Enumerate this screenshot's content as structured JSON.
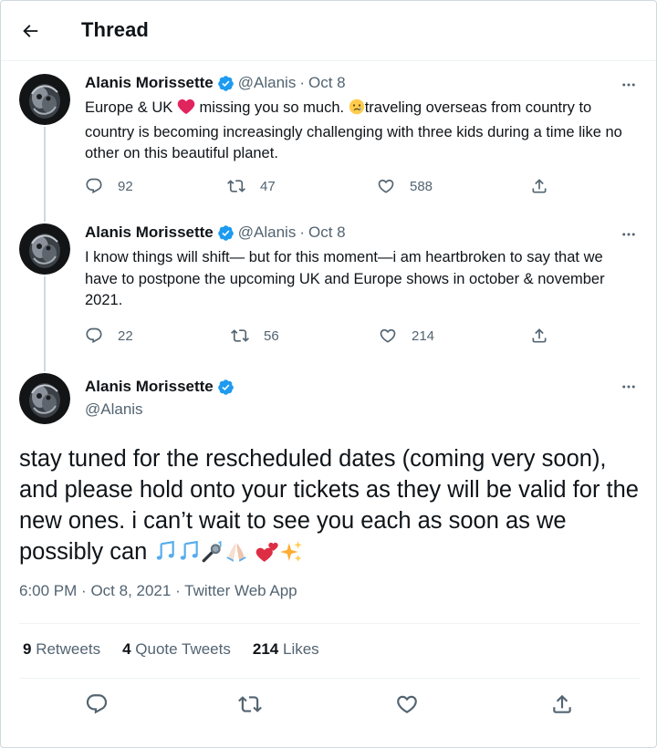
{
  "header": {
    "title": "Thread"
  },
  "tweets": [
    {
      "name": "Alanis Morissette",
      "handle": "@Alanis",
      "dot": "·",
      "date": "Oct 8",
      "text_a": "Europe & UK ",
      "text_b": " missing you so much. ",
      "text_c": "traveling overseas from country to country is becoming increasingly challenging with three kids during a time like no other on this beautiful planet.",
      "replies": "92",
      "retweets": "47",
      "likes": "588"
    },
    {
      "name": "Alanis Morissette",
      "handle": "@Alanis",
      "dot": "·",
      "date": "Oct 8",
      "text": "I know things will shift— but for this moment—i am heartbroken to say that we have to postpone the upcoming UK and Europe shows in october & november 2021.",
      "replies": "22",
      "retweets": "56",
      "likes": "214"
    }
  ],
  "main_tweet": {
    "name": "Alanis Morissette",
    "handle": "@Alanis",
    "text": "stay tuned for the rescheduled dates (coming very soon), and please hold onto your tickets as they will be valid for the new ones. i can’t wait to see you each as soon as we possibly can ",
    "time": "6:00 PM",
    "dot": "·",
    "date": "Oct 8, 2021",
    "source": "Twitter Web App",
    "retweets_count": "9",
    "retweets_label": "Retweets",
    "quotes_count": "4",
    "quotes_label": "Quote Tweets",
    "likes_count": "214",
    "likes_label": "Likes"
  },
  "icons": {
    "back": "arrow-left-icon",
    "verified": "verified-badge-icon",
    "more": "more-horizontal-icon",
    "reply": "reply-icon",
    "retweet": "retweet-icon",
    "like": "heart-icon",
    "share": "share-icon"
  },
  "colors": {
    "accent": "#1d9bf0",
    "muted": "#536471",
    "text": "#0f1419",
    "border": "#cfd9de"
  }
}
